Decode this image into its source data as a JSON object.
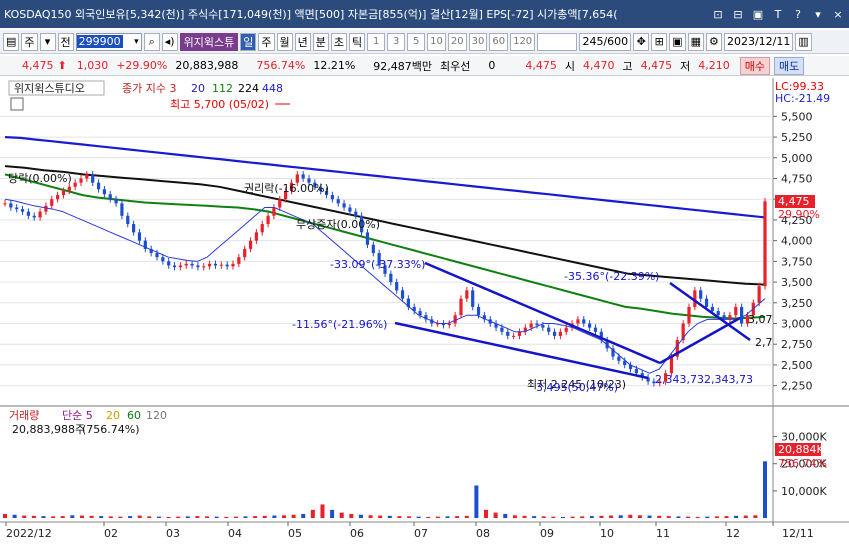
{
  "window": {
    "title": "KOSDAQ150 외국인보유[5,342(천)] 주식수[171,049(천)] 액면[500] 자본금[855(억)] 결산[12월] EPS[-72] 시가총액[7,654(",
    "buttons": [
      "⊡",
      "⊟",
      "▣",
      "T",
      "?",
      "▾",
      "×"
    ]
  },
  "toolbar": {
    "type_label": "주",
    "all_label": "전",
    "code_value": "299900",
    "speaker_icon": "speaker-icon",
    "name_label": "위지윅스튜",
    "periods": [
      "일",
      "주",
      "월",
      "년",
      "분",
      "초",
      "틱"
    ],
    "active_period": "일",
    "intervals": [
      "1",
      "3",
      "5",
      "10",
      "20",
      "30",
      "60",
      "120"
    ],
    "count_display": "245/600",
    "date_value": "2023/12/11"
  },
  "infobar": {
    "price": "4,475",
    "change": "1,030",
    "change_pct": "+29.90%",
    "volume": "20,883,988",
    "vol_ratio": "756.74%",
    "turnover": "12.21%",
    "amount": "92,487백만",
    "pref_label": "최우선",
    "pref_value": "0",
    "ask_price": "4,475",
    "open_label": "시",
    "open_value": "4,470",
    "high_label": "고",
    "high_value": "4,475",
    "low_label": "저",
    "low_value": "4,210",
    "buy_label": "매수",
    "sell_label": "매도"
  },
  "price_panel": {
    "stock_name": "위지윅스튜디오",
    "indicator_label": "종가 지수 3",
    "ma_periods": [
      "20",
      "112",
      "224",
      "448"
    ],
    "lc_label": "LC:99.33",
    "hc_label": "HC:-21.49",
    "y_ticks": [
      "5,500",
      "5,250",
      "5,000",
      "4,750",
      "4,500",
      "4,250",
      "4,000",
      "3,750",
      "3,500",
      "3,250",
      "3,000",
      "2,750",
      "2,500",
      "2,250"
    ],
    "current_price_tag": "4,475",
    "current_pct_tag": "29.90%",
    "annotations": {
      "high": "최고 5,700 (05/02)",
      "low": "최저 2,245 (10/23)",
      "rights": "권리락(-16.00%)",
      "capital_reduction": "무상증자(0.00%)",
      "ex_div": "당락(0.00%)",
      "trend1": "-33.09°(-37.33%)",
      "trend2": "-11.56°(-21.96%)",
      "trend3": "-35.36°(-22.39%)",
      "fan_values": "2,343,732,343,73",
      "low_overlap": "3,495(50,47%)",
      "right_3070": "3,07",
      "right_2750": "2,7"
    }
  },
  "volume_panel": {
    "label": "거래량",
    "ma_label": "단순 5",
    "ma_periods": [
      "20",
      "60",
      "120"
    ],
    "volume_text": "20,883,988주",
    "volume_ratio_text": "(756.74%)",
    "y_ticks": [
      "30,000K",
      "20,000K",
      "10,000K"
    ],
    "tag_volume": "20,884K",
    "tag_pct": "756.74%"
  },
  "x_axis": {
    "labels": [
      "2022/12",
      "02",
      "03",
      "04",
      "05",
      "06",
      "07",
      "08",
      "09",
      "10",
      "11",
      "12",
      "12/11"
    ]
  },
  "chart_data": {
    "type": "candlestick",
    "x_range": [
      "2022/12",
      "2023/12/11"
    ],
    "ylim": [
      2125,
      5625
    ],
    "close_series": [
      4450,
      4400,
      4380,
      4350,
      4300,
      4280,
      4350,
      4420,
      4500,
      4550,
      4600,
      4650,
      4700,
      4750,
      4800,
      4700,
      4620,
      4560,
      4500,
      4450,
      4300,
      4200,
      4100,
      4000,
      3900,
      3850,
      3800,
      3750,
      3700,
      3680,
      3700,
      3720,
      3700,
      3680,
      3690,
      3720,
      3700,
      3710,
      3690,
      3720,
      3800,
      3900,
      4000,
      4100,
      4200,
      4300,
      4400,
      4500,
      4600,
      4700,
      4800,
      4750,
      4700,
      4650,
      4600,
      4550,
      4500,
      4450,
      4400,
      4350,
      4300,
      4100,
      3950,
      3850,
      3700,
      3600,
      3500,
      3400,
      3300,
      3200,
      3150,
      3100,
      3050,
      3000,
      3000,
      2980,
      3000,
      3100,
      3300,
      3400,
      3200,
      3100,
      3050,
      3000,
      2950,
      2900,
      2850,
      2850,
      2900,
      2950,
      3000,
      2980,
      2950,
      2900,
      2850,
      2900,
      2950,
      3000,
      3050,
      3000,
      2950,
      2900,
      2800,
      2700,
      2600,
      2550,
      2500,
      2450,
      2400,
      2350,
      2300,
      2280,
      2300,
      2400,
      2600,
      2800,
      3000,
      3200,
      3400,
      3300,
      3200,
      3150,
      3100,
      3050,
      3100,
      3200,
      3000,
      3100,
      3250,
      3450,
      4475
    ],
    "ma20": [
      4500,
      4480,
      4450,
      4420,
      4400,
      4380,
      4350,
      4300,
      4250,
      4200,
      4150,
      4100,
      4050,
      4000,
      3950,
      3900,
      3850,
      3800,
      3780,
      3760,
      3750,
      3800,
      3900,
      4000,
      4100,
      4200,
      4300,
      4400,
      4400,
      4350,
      4300,
      4250,
      4200,
      4100,
      4000,
      3900,
      3800,
      3700,
      3600,
      3500,
      3400,
      3300,
      3200,
      3100,
      3050,
      3000,
      3000,
      3050,
      3100,
      3100,
      3050,
      3000,
      2950,
      2900,
      2900,
      2950,
      3000,
      3000,
      2980,
      2950,
      2900,
      2850,
      2800,
      2700,
      2600,
      2500,
      2450,
      2400,
      2450,
      2600,
      2750,
      2900,
      3000,
      3050,
      3050,
      3050,
      3050,
      3100,
      3200,
      3300
    ],
    "ma112": [
      4800,
      4750,
      4700,
      4650,
      4600,
      4550,
      4520,
      4500,
      4480,
      4460,
      4450,
      4440,
      4430,
      4420,
      4410,
      4400,
      4380,
      4350,
      4300,
      4250,
      4200,
      4150,
      4100,
      4050,
      4000,
      3950,
      3900,
      3850,
      3800,
      3750,
      3700,
      3650,
      3600,
      3550,
      3500,
      3450,
      3400,
      3350,
      3300,
      3250,
      3200,
      3180,
      3150,
      3120,
      3100,
      3080,
      3070,
      3060,
      3070,
      3080
    ],
    "ma224": [
      4900,
      4880,
      4850,
      4830,
      4800,
      4780,
      4760,
      4740,
      4720,
      4700,
      4680,
      4650,
      4600,
      4550,
      4500,
      4450,
      4400,
      4350,
      4300,
      4250,
      4200,
      4150,
      4100,
      4050,
      4000,
      3950,
      3900,
      3850,
      3800,
      3750,
      3700,
      3650,
      3600,
      3580,
      3560,
      3540,
      3520,
      3500,
      3480,
      3470
    ],
    "ma448": [
      5250,
      5240,
      5220,
      5200,
      5180,
      5160,
      5140,
      5120,
      5100,
      5080,
      5060,
      5040,
      5020,
      5000,
      4980,
      4960,
      4940,
      4920,
      4900,
      4880,
      4860,
      4840,
      4820,
      4800,
      4780,
      4760,
      4740,
      4720,
      4700,
      4680,
      4660,
      4640,
      4620,
      4600,
      4580,
      4560,
      4540,
      4520,
      4500,
      4480,
      4460,
      4440,
      4420,
      4400,
      4380,
      4360,
      4340,
      4320,
      4300,
      4280
    ],
    "volume_k": [
      1500,
      1200,
      900,
      800,
      700,
      600,
      700,
      1000,
      900,
      800,
      700,
      600,
      500,
      700,
      900,
      600,
      500,
      400,
      500,
      600,
      700,
      600,
      500,
      400,
      500,
      600,
      700,
      800,
      900,
      1000,
      1200,
      1500,
      3000,
      5000,
      3000,
      2000,
      1500,
      1200,
      1000,
      900,
      800,
      700,
      600,
      500,
      400,
      500,
      600,
      700,
      800,
      12000,
      3000,
      2000,
      1500,
      1000,
      800,
      700,
      600,
      500,
      400,
      500,
      600,
      700,
      800,
      900,
      1000,
      1200,
      1000,
      900,
      800,
      700,
      600,
      500,
      400,
      500,
      600,
      700,
      800,
      900,
      1000,
      20884
    ]
  }
}
